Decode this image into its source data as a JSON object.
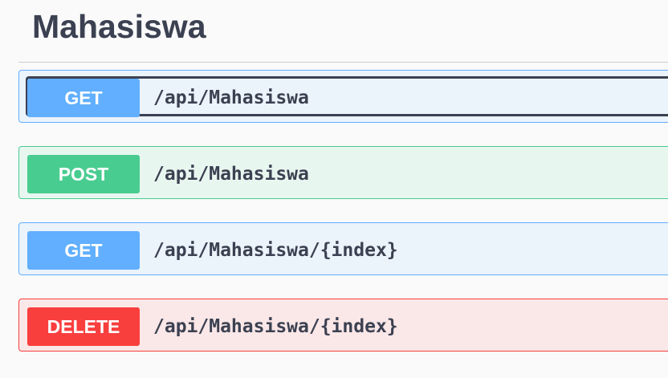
{
  "section": {
    "title": "Mahasiswa"
  },
  "operations": [
    {
      "method": "GET",
      "path": "/api/Mahasiswa"
    },
    {
      "method": "POST",
      "path": "/api/Mahasiswa"
    },
    {
      "method": "GET",
      "path": "/api/Mahasiswa/{index}"
    },
    {
      "method": "DELETE",
      "path": "/api/Mahasiswa/{index}"
    }
  ],
  "colors": {
    "get": "#61affe",
    "post": "#49cc90",
    "delete": "#f93e3e",
    "text": "#3b4151"
  }
}
